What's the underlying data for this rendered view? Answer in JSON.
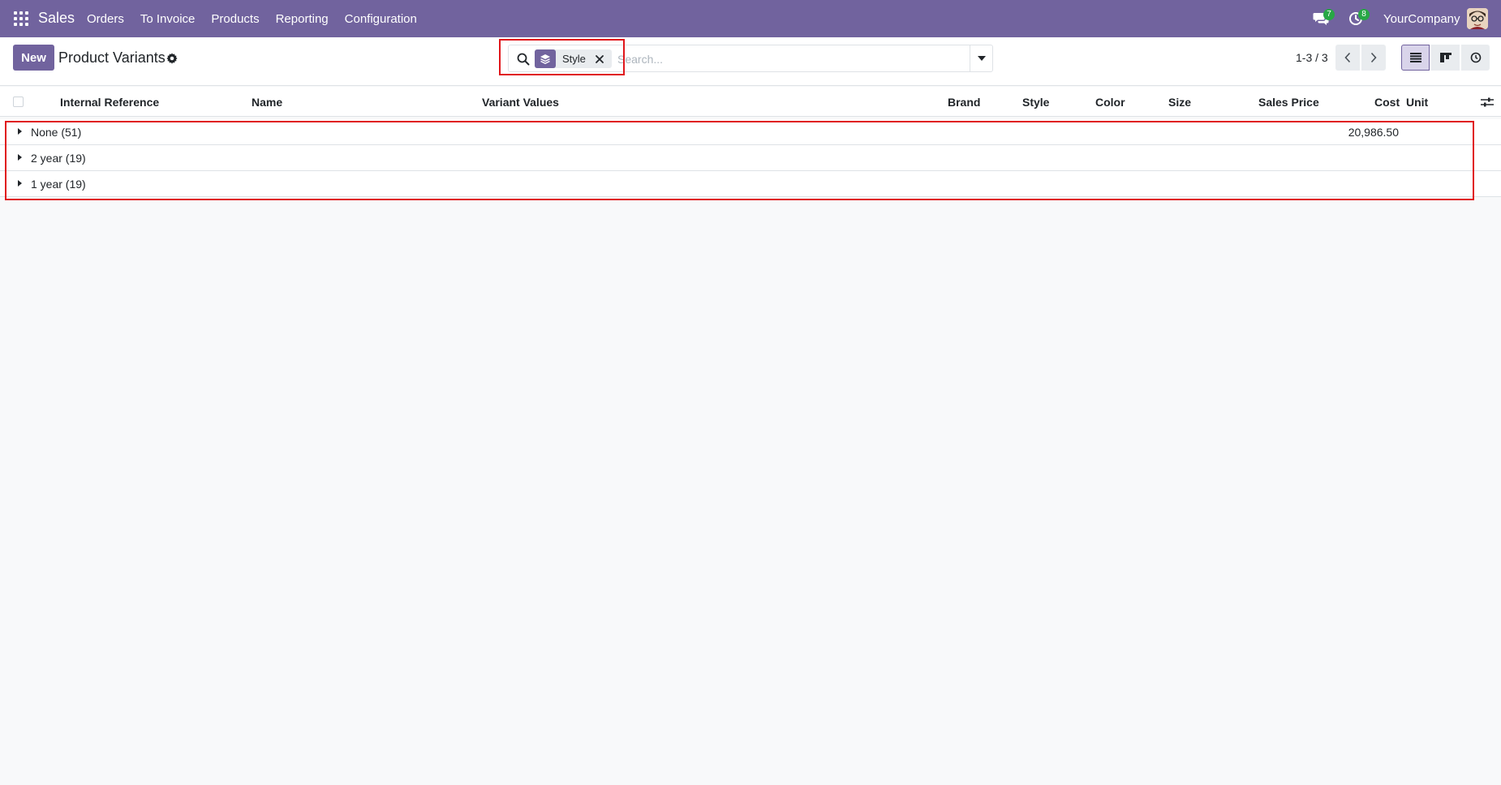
{
  "navbar": {
    "app_name": "Sales",
    "menu": [
      "Orders",
      "To Invoice",
      "Products",
      "Reporting",
      "Configuration"
    ],
    "messages_count": "7",
    "activities_count": "8",
    "company": "YourCompany"
  },
  "control_panel": {
    "new_label": "New",
    "title": "Product Variants",
    "search": {
      "facet_label": "Style",
      "placeholder": "Search..."
    },
    "pager": "1-3 / 3"
  },
  "list": {
    "columns": {
      "internal_reference": "Internal Reference",
      "name": "Name",
      "variant_values": "Variant Values",
      "brand": "Brand",
      "style": "Style",
      "color": "Color",
      "size": "Size",
      "sales_price": "Sales Price",
      "cost": "Cost",
      "unit": "Unit"
    },
    "groups": [
      {
        "label": "None (51)",
        "cost": "20,986.50"
      },
      {
        "label": "2 year (19)",
        "cost": ""
      },
      {
        "label": "1 year (19)",
        "cost": ""
      }
    ]
  },
  "colors": {
    "brand": "#71639e",
    "badge": "#28a745",
    "highlight": "#e0161b"
  },
  "icons": [
    "apps-grid-icon",
    "chat-icon",
    "activity-clock-icon",
    "gear-icon",
    "search-icon",
    "layers-icon",
    "close-icon",
    "caret-down-icon",
    "chevron-left-icon",
    "chevron-right-icon",
    "list-view-icon",
    "kanban-view-icon",
    "activity-view-icon",
    "sliders-icon",
    "caret-right-icon"
  ]
}
